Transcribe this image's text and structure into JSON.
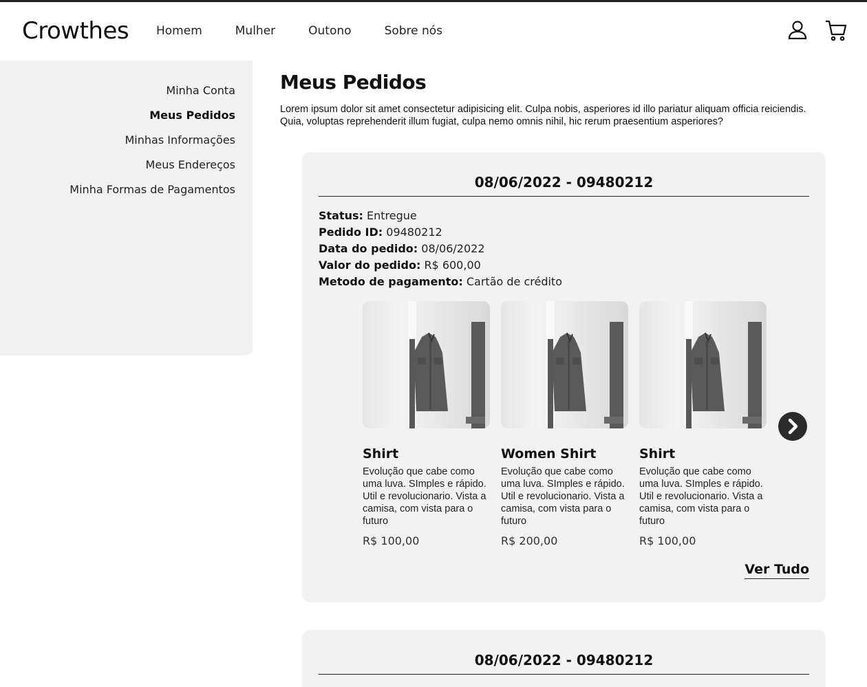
{
  "brand": {
    "logo": "Crowthes"
  },
  "nav": {
    "items": [
      {
        "label": "Homem"
      },
      {
        "label": "Mulher"
      },
      {
        "label": "Outono"
      },
      {
        "label": "Sobre nós"
      }
    ],
    "icons": [
      "user-icon",
      "cart-icon"
    ]
  },
  "sidebar": {
    "items": [
      {
        "label": "Minha Conta"
      },
      {
        "label": "Meus Pedidos",
        "active": true
      },
      {
        "label": "Minhas Informações"
      },
      {
        "label": "Meus Endereços"
      },
      {
        "label": "Minha Formas de Pagamentos"
      }
    ]
  },
  "main": {
    "title": "Meus Pedidos",
    "description": "Lorem ipsum dolor sit amet consectetur adipisicing elit. Culpa nobis, asperiores id illo pariatur aliquam officia reiciendis. Quia, voluptas reprehenderit illum fugiat, culpa nemo omnis nihil, hic rerum praesentium asperiores?"
  },
  "orders": [
    {
      "header": "08/06/2022 - 09480212",
      "info": [
        {
          "label": "Status:",
          "value": "Entregue"
        },
        {
          "label": "Pedido ID:",
          "value": "09480212"
        },
        {
          "label": "Data do pedido:",
          "value": "08/06/2022"
        },
        {
          "label": "Valor do pedido:",
          "value": "R$ 600,00"
        },
        {
          "label": "Metodo de pagamento:",
          "value": "Cartão de crédito"
        }
      ],
      "products": [
        {
          "name": "Shirt",
          "description": "Evolução que cabe como uma luva. SImples e rápido. Util e revolucionario. Vista a camisa, com vista para o futuro",
          "price": "R$ 100,00"
        },
        {
          "name": "Women Shirt",
          "description": "Evolução que cabe como uma luva. SImples e rápido. Util e revolucionario. Vista a camisa, com vista para o futuro",
          "price": "R$ 200,00"
        },
        {
          "name": "Shirt",
          "description": "Evolução que cabe como uma luva. SImples e rápido. Util e revolucionario. Vista a camisa, com vista para o futuro",
          "price": "R$ 100,00"
        }
      ],
      "see_all_label": "Ver Tudo"
    },
    {
      "header": "08/06/2022 - 09480212"
    }
  ],
  "colors": {
    "panel_bg": "#f2f2f2",
    "text": "#111111",
    "accent_dark": "#222222"
  }
}
